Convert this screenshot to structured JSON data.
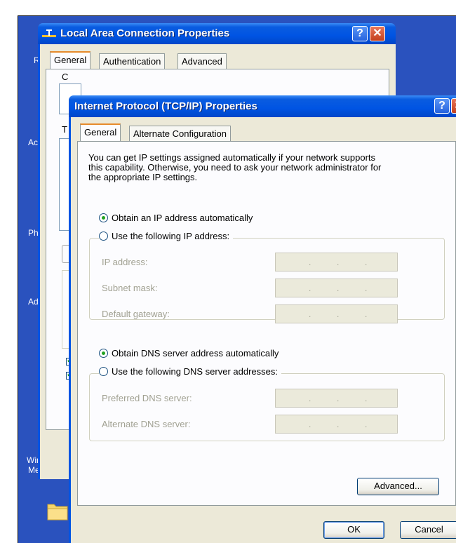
{
  "desktop": {
    "labels_left": [
      "R",
      "Ac",
      "Ph",
      "Ad"
    ],
    "taskbar_label_line1": "Windows",
    "taskbar_label_line2": "Messer",
    "folder_icon": "folder-icon",
    "colors": {
      "desktop": "#2a52be"
    }
  },
  "lan_window": {
    "title": "Local Area Connection Properties",
    "tabs": [
      "General",
      "Authentication",
      "Advanced"
    ],
    "peek_letter_1": "C",
    "peek_letter_2": "T"
  },
  "tcp_window": {
    "title": "Internet Protocol (TCP/IP) Properties",
    "tabs": [
      "General",
      "Alternate Configuration"
    ],
    "description": "You can get IP settings assigned automatically if your network supports this capability. Otherwise, you need to ask your network administrator for the appropriate IP settings.",
    "description_lines": [
      "You can get IP settings assigned automatically if your network supports",
      "this capability. Otherwise, you need to ask your network administrator for",
      "the appropriate IP settings."
    ],
    "ip_options": {
      "auto_label": "Obtain an IP address automatically",
      "manual_label": "Use the following IP address:",
      "selected": "auto"
    },
    "ip_fields": [
      {
        "label": "IP address:",
        "value": ". . ."
      },
      {
        "label": "Subnet mask:",
        "value": ". . ."
      },
      {
        "label": "Default gateway:",
        "value": ". . ."
      }
    ],
    "dns_options": {
      "auto_label": "Obtain DNS server address automatically",
      "manual_label": "Use the following DNS server addresses:",
      "selected": "auto"
    },
    "dns_fields": [
      {
        "label": "Preferred DNS server:",
        "value": ". . ."
      },
      {
        "label": "Alternate DNS server:",
        "value": ". . ."
      }
    ],
    "advanced_button": "Advanced...",
    "ok_button": "OK",
    "cancel_button": "Cancel",
    "help_glyph": "?",
    "close_glyph": "✕"
  }
}
